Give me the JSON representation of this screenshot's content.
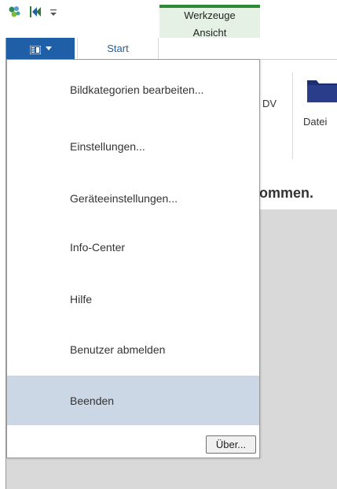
{
  "quick_access": {
    "icons": [
      "app-logo-icon",
      "first-page-icon",
      "customize-dropdown-icon"
    ]
  },
  "ribbon_tabs": {
    "context_group_title": "Werkzeuge",
    "context_tab": "Ansicht",
    "start": "Start"
  },
  "ribbon": {
    "partial_label_1": "DV",
    "partial_label_2": "Datei"
  },
  "content": {
    "heading_partial": "ommen."
  },
  "app_menu": {
    "items": [
      {
        "label": "Bildkategorien bearbeiten..."
      },
      {
        "label": "Einstellungen..."
      },
      {
        "label": "Geräteeinstellungen..."
      },
      {
        "label": "Info-Center"
      },
      {
        "label": "Hilfe"
      },
      {
        "label": "Benutzer abmelden"
      },
      {
        "label": "Beenden"
      }
    ],
    "about_label": "Über..."
  },
  "colors": {
    "app_button": "#1e5fa8",
    "context_accent": "#2e8b35",
    "context_bg": "#e6f1e6",
    "menu_highlight": "#ccd7e6",
    "content_bg": "#d9d9d9"
  }
}
